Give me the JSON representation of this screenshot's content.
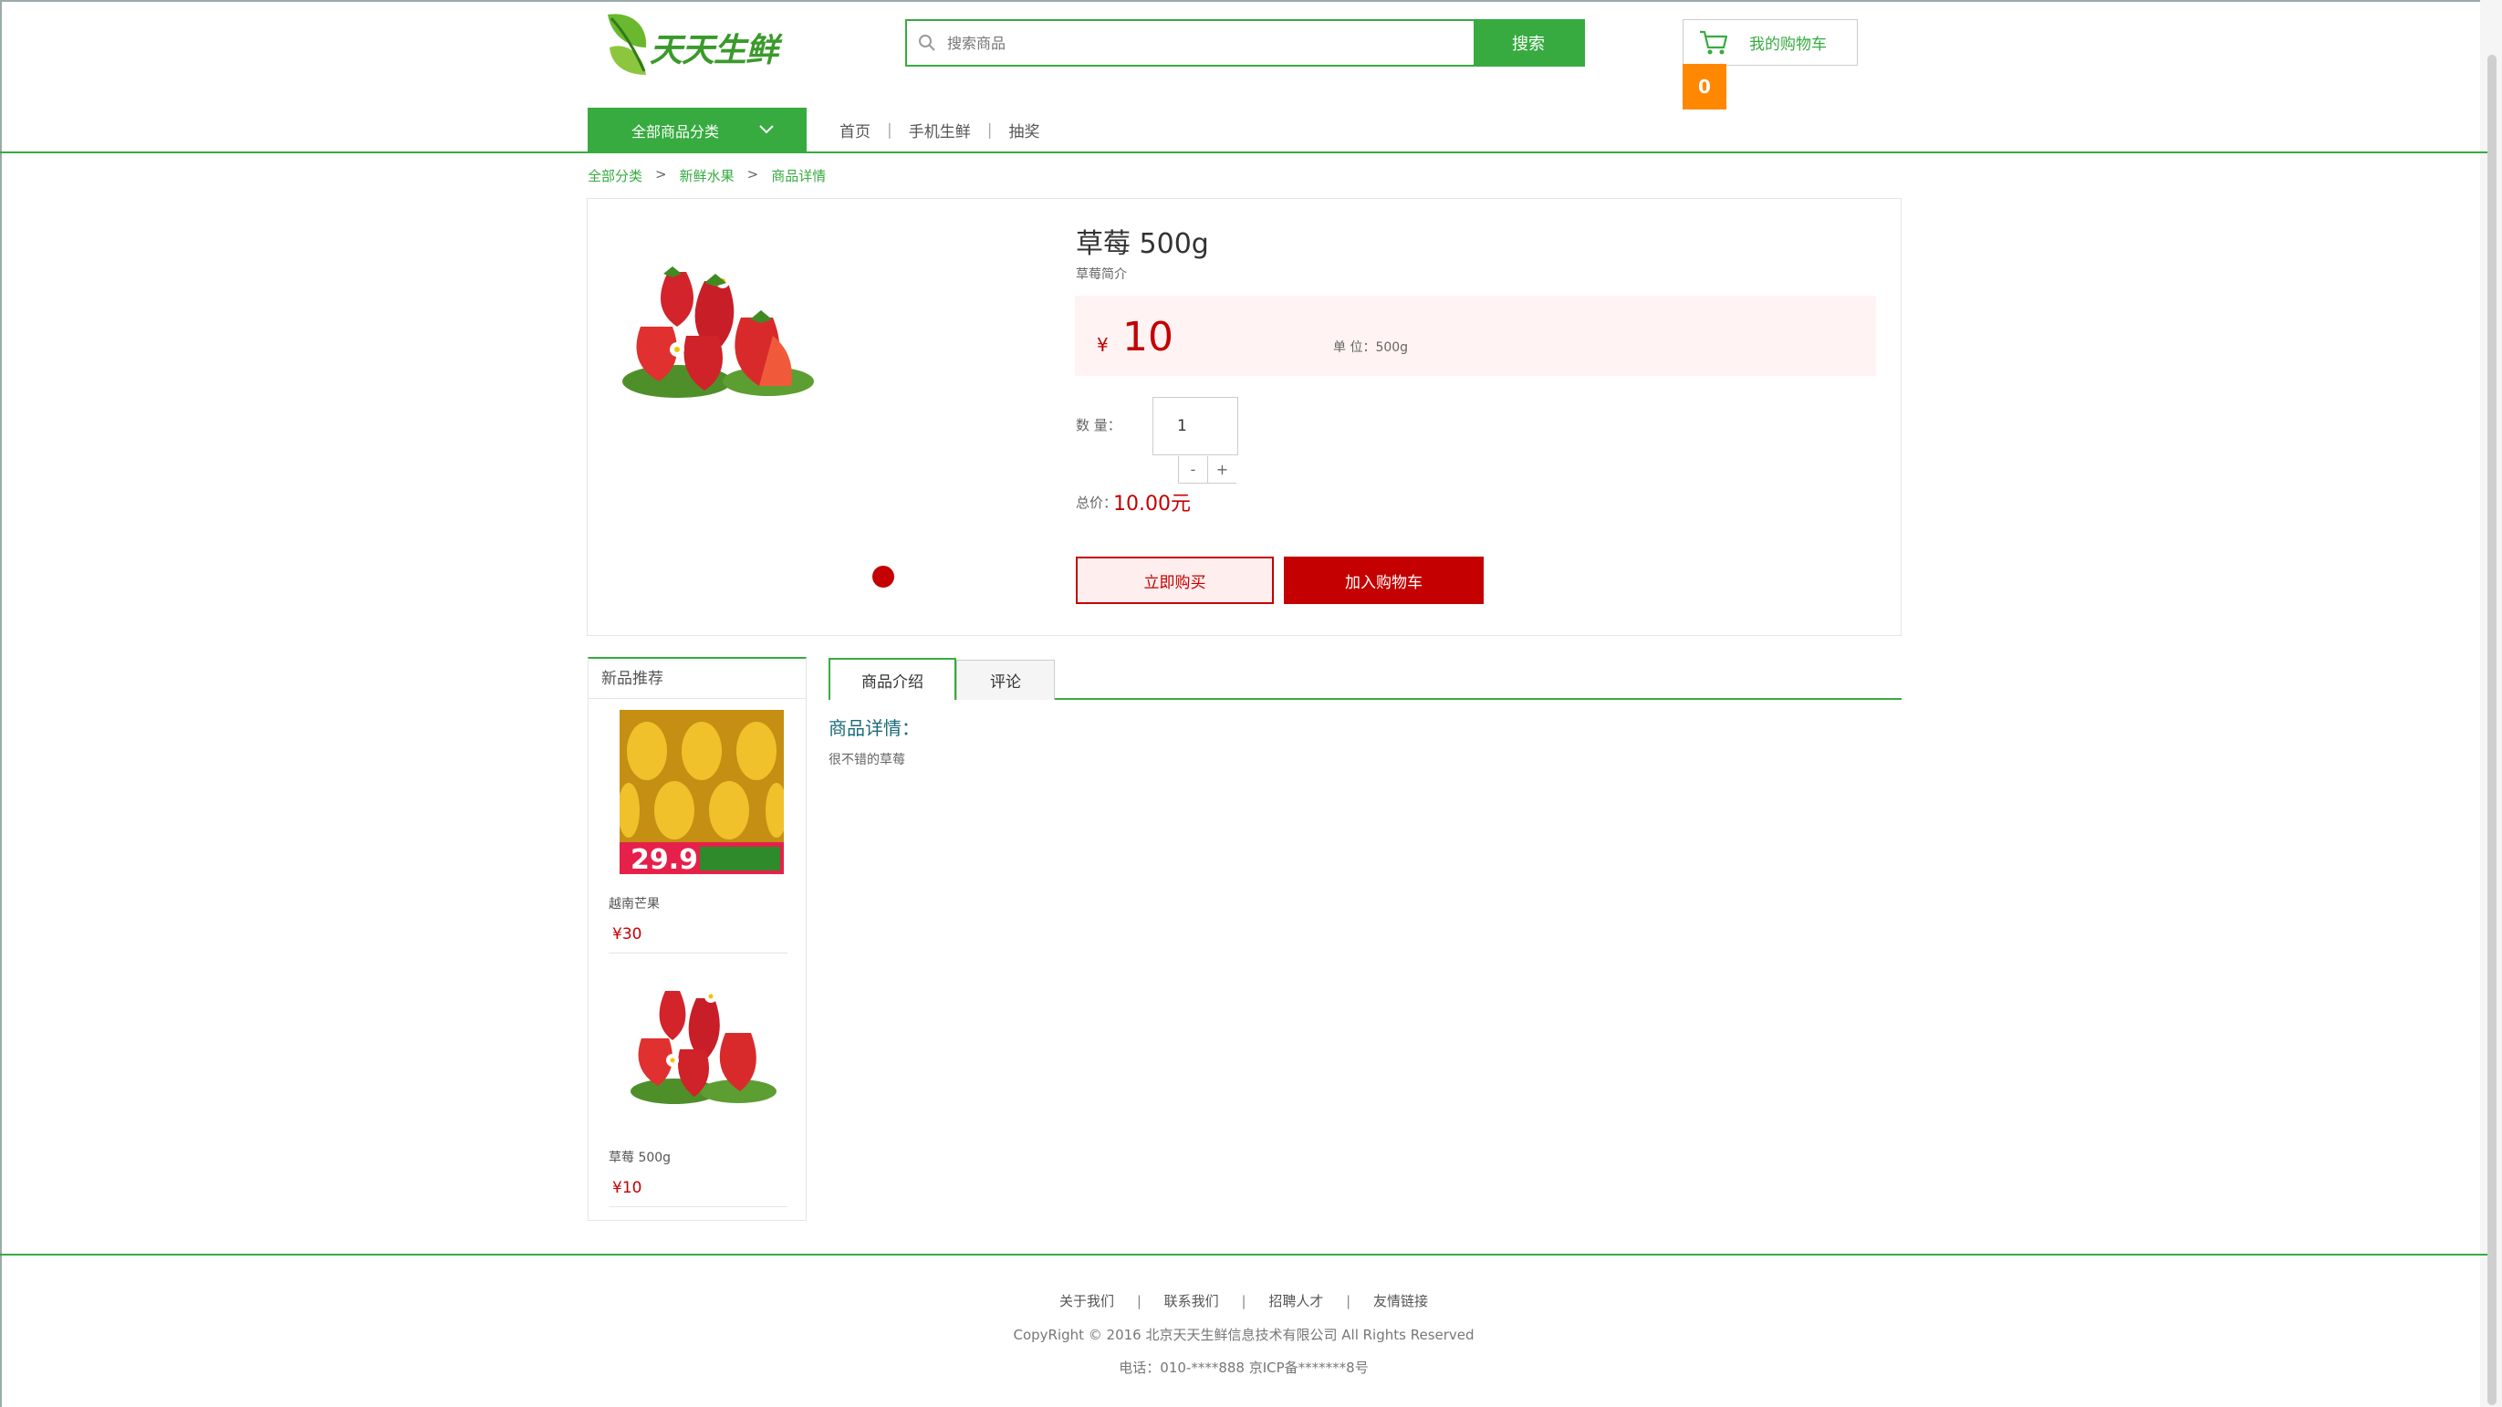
{
  "header": {
    "logo_text": "天天生鲜",
    "search_placeholder": "搜索商品",
    "search_button": "搜索",
    "cart_label": "我的购物车",
    "cart_count": "0"
  },
  "nav": {
    "all_categories": "全部商品分类",
    "links": [
      "首页",
      "手机生鲜",
      "抽奖"
    ]
  },
  "breadcrumb": [
    "全部分类",
    "新鲜水果",
    "商品详情"
  ],
  "product": {
    "title": "草莓 500g",
    "brief": "草莓简介",
    "currency": "¥",
    "price": "10",
    "unit": "单 位：500g",
    "qty_label": "数 量：",
    "qty_value": "1",
    "minus": "-",
    "plus": "+",
    "total_label": "总价：",
    "total": "10.00元",
    "buy_now": "立即购买",
    "add_to_cart": "加入购物车"
  },
  "new_products": {
    "title": "新品推荐",
    "items": [
      {
        "name": "越南芒果",
        "price": "¥30"
      },
      {
        "name": "草莓 500g",
        "price": "¥10"
      }
    ]
  },
  "tabs": [
    "商品介绍",
    "评论"
  ],
  "detail": {
    "title": "商品详情：",
    "text": "很不错的草莓"
  },
  "footer": {
    "links": [
      "关于我们",
      "联系我们",
      "招聘人才",
      "友情链接"
    ],
    "copyright": "CopyRight © 2016 北京天天生鲜信息技术有限公司 All Rights Reserved",
    "tel": "电话：010-****888 京ICP备*******8号"
  },
  "colors": {
    "brand_green": "#37ab40",
    "price_red": "#c40000",
    "cart_orange": "#ff8800"
  }
}
